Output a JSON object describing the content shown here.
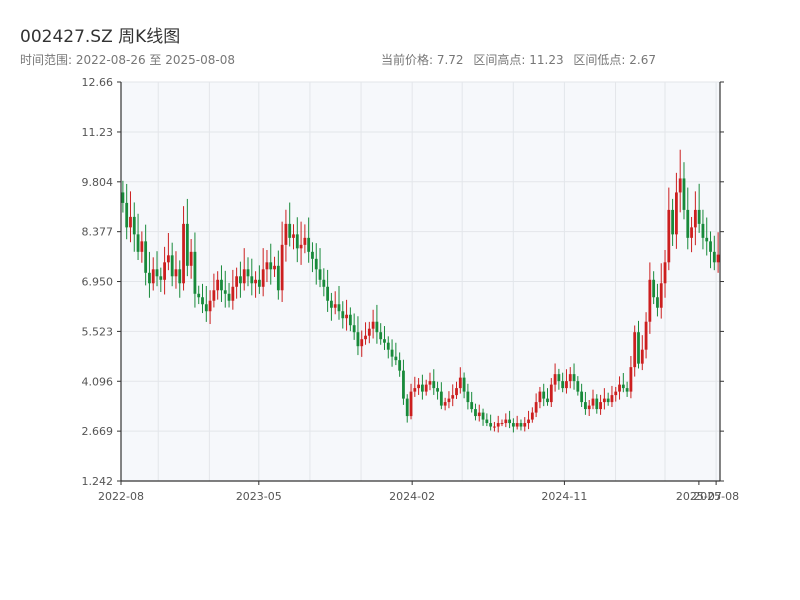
{
  "header": {
    "title": "002427.SZ 周K线图",
    "date_range": "时间范围: 2022-08-26 至 2025-08-08",
    "current_price": "当前价格: 7.72",
    "range_high": "区间高点: 11.23",
    "range_low": "区间低点: 2.67"
  },
  "colors": {
    "up": "#cc1f1f",
    "down": "#188a3a",
    "plot_bg": "#f6f8fb",
    "grid": "#e3e6ea",
    "axis": "#333333"
  },
  "chart_data": {
    "type": "candlestick",
    "title": "002427.SZ 周K线图",
    "ylim": [
      1.242,
      12.66
    ],
    "y_ticks": [
      "1.242",
      "2.669",
      "4.096",
      "5.523",
      "6.950",
      "8.377",
      "9.804",
      "11.23",
      "12.66"
    ],
    "x_ticks": [
      "2022-08",
      "2023-05",
      "2024-02",
      "2024-11",
      "2025-07",
      "2025-08"
    ],
    "grid": true,
    "x_start": "2022-08-26",
    "x_end": "2025-08-08",
    "interval_days": 7,
    "close": [
      9.2,
      8.5,
      8.8,
      8.3,
      7.8,
      8.1,
      7.2,
      6.9,
      7.3,
      7.1,
      7.0,
      7.5,
      7.7,
      7.1,
      7.3,
      6.9,
      8.6,
      7.4,
      7.8,
      6.6,
      6.5,
      6.3,
      6.1,
      6.4,
      6.7,
      7.0,
      6.7,
      6.6,
      6.4,
      6.8,
      7.1,
      6.9,
      7.3,
      7.1,
      6.9,
      7.0,
      6.8,
      7.3,
      7.5,
      7.3,
      7.4,
      6.7,
      8.0,
      8.6,
      8.2,
      8.3,
      7.9,
      8.0,
      8.2,
      7.8,
      7.6,
      7.3,
      7.0,
      6.8,
      6.4,
      6.2,
      6.3,
      6.1,
      5.9,
      6.0,
      5.7,
      5.5,
      5.1,
      5.3,
      5.4,
      5.6,
      5.8,
      5.5,
      5.3,
      5.2,
      5.0,
      4.8,
      4.7,
      4.4,
      3.6,
      3.1,
      3.8,
      3.9,
      4.0,
      3.8,
      4.0,
      4.1,
      3.9,
      3.8,
      3.4,
      3.5,
      3.6,
      3.7,
      3.9,
      4.2,
      3.8,
      3.5,
      3.3,
      3.1,
      3.2,
      3.0,
      2.9,
      2.8,
      2.8,
      2.9,
      2.9,
      3.0,
      2.9,
      2.8,
      2.9,
      2.8,
      2.9,
      3.0,
      3.2,
      3.5,
      3.8,
      3.6,
      3.5,
      4.0,
      4.3,
      4.1,
      3.9,
      4.1,
      4.3,
      4.1,
      3.8,
      3.5,
      3.3,
      3.4,
      3.6,
      3.3,
      3.5,
      3.6,
      3.5,
      3.7,
      3.8,
      4.0,
      3.9,
      3.8,
      4.5,
      5.5,
      4.6,
      5.0,
      5.8,
      7.0,
      6.5,
      6.2,
      6.9,
      7.5,
      9.0,
      8.3,
      9.5,
      9.9,
      9.0,
      8.2,
      8.5,
      9.0,
      8.6,
      8.2,
      8.1,
      7.8,
      7.5,
      7.72
    ]
  }
}
